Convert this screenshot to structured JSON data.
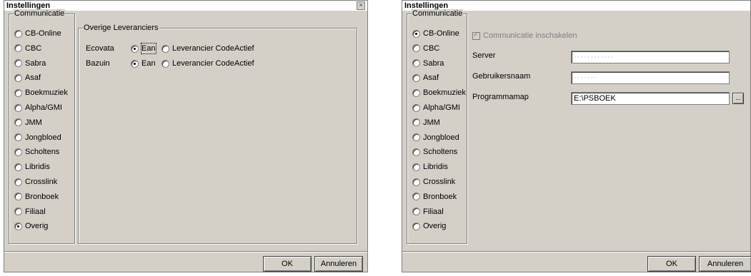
{
  "dialog_left": {
    "title": "Instellingen",
    "close_glyph": "×",
    "communication_group_label": "Communicatie",
    "suppliers": [
      {
        "label": "CB-Online",
        "selected": false
      },
      {
        "label": "CBC",
        "selected": false
      },
      {
        "label": "Sabra",
        "selected": false
      },
      {
        "label": "Asaf",
        "selected": false
      },
      {
        "label": "Boekmuziek",
        "selected": false
      },
      {
        "label": "Alpha/GMI",
        "selected": false
      },
      {
        "label": "JMM",
        "selected": false
      },
      {
        "label": "Jongbloed",
        "selected": false
      },
      {
        "label": "Scholtens",
        "selected": false
      },
      {
        "label": "Libridis",
        "selected": false
      },
      {
        "label": "Crosslink",
        "selected": false
      },
      {
        "label": "Bronboek",
        "selected": false
      },
      {
        "label": "Filiaal",
        "selected": false
      },
      {
        "label": "Overig",
        "selected": true
      }
    ],
    "other_suppliers_group_label": "Overige Leveranciers",
    "other_rows": [
      {
        "name": "Ecovata",
        "option_ean": "Ean",
        "option_code": "Leverancier Code",
        "status": "Actief",
        "ean_selected": true
      },
      {
        "name": "Bazuin",
        "option_ean": "Ean",
        "option_code": "Leverancier Code",
        "status": "Actief",
        "ean_selected": true
      }
    ],
    "ok_label": "OK",
    "cancel_label": "Annuleren"
  },
  "dialog_right": {
    "title": "Instellingen",
    "communication_group_label": "Communicatie",
    "suppliers": [
      {
        "label": "CB-Online",
        "selected": true
      },
      {
        "label": "CBC",
        "selected": false
      },
      {
        "label": "Sabra",
        "selected": false
      },
      {
        "label": "Asaf",
        "selected": false
      },
      {
        "label": "Boekmuziek",
        "selected": false
      },
      {
        "label": "Alpha/GMI",
        "selected": false
      },
      {
        "label": "JMM",
        "selected": false
      },
      {
        "label": "Jongbloed",
        "selected": false
      },
      {
        "label": "Scholtens",
        "selected": false
      },
      {
        "label": "Libridis",
        "selected": false
      },
      {
        "label": "Crosslink",
        "selected": false
      },
      {
        "label": "Bronboek",
        "selected": false
      },
      {
        "label": "Filiaal",
        "selected": false
      },
      {
        "label": "Overig",
        "selected": false
      }
    ],
    "enable_communication_label": "Communicatie inschakelen",
    "enable_communication_checked": true,
    "server_label": "Server",
    "server_value": "············",
    "username_label": "Gebruikersnaam",
    "username_value": "·······",
    "program_folder_label": "Programmamap",
    "program_folder_value": "E:\\PSBOEK",
    "browse_label": "...",
    "ok_label": "OK",
    "cancel_label": "Annuleren"
  }
}
